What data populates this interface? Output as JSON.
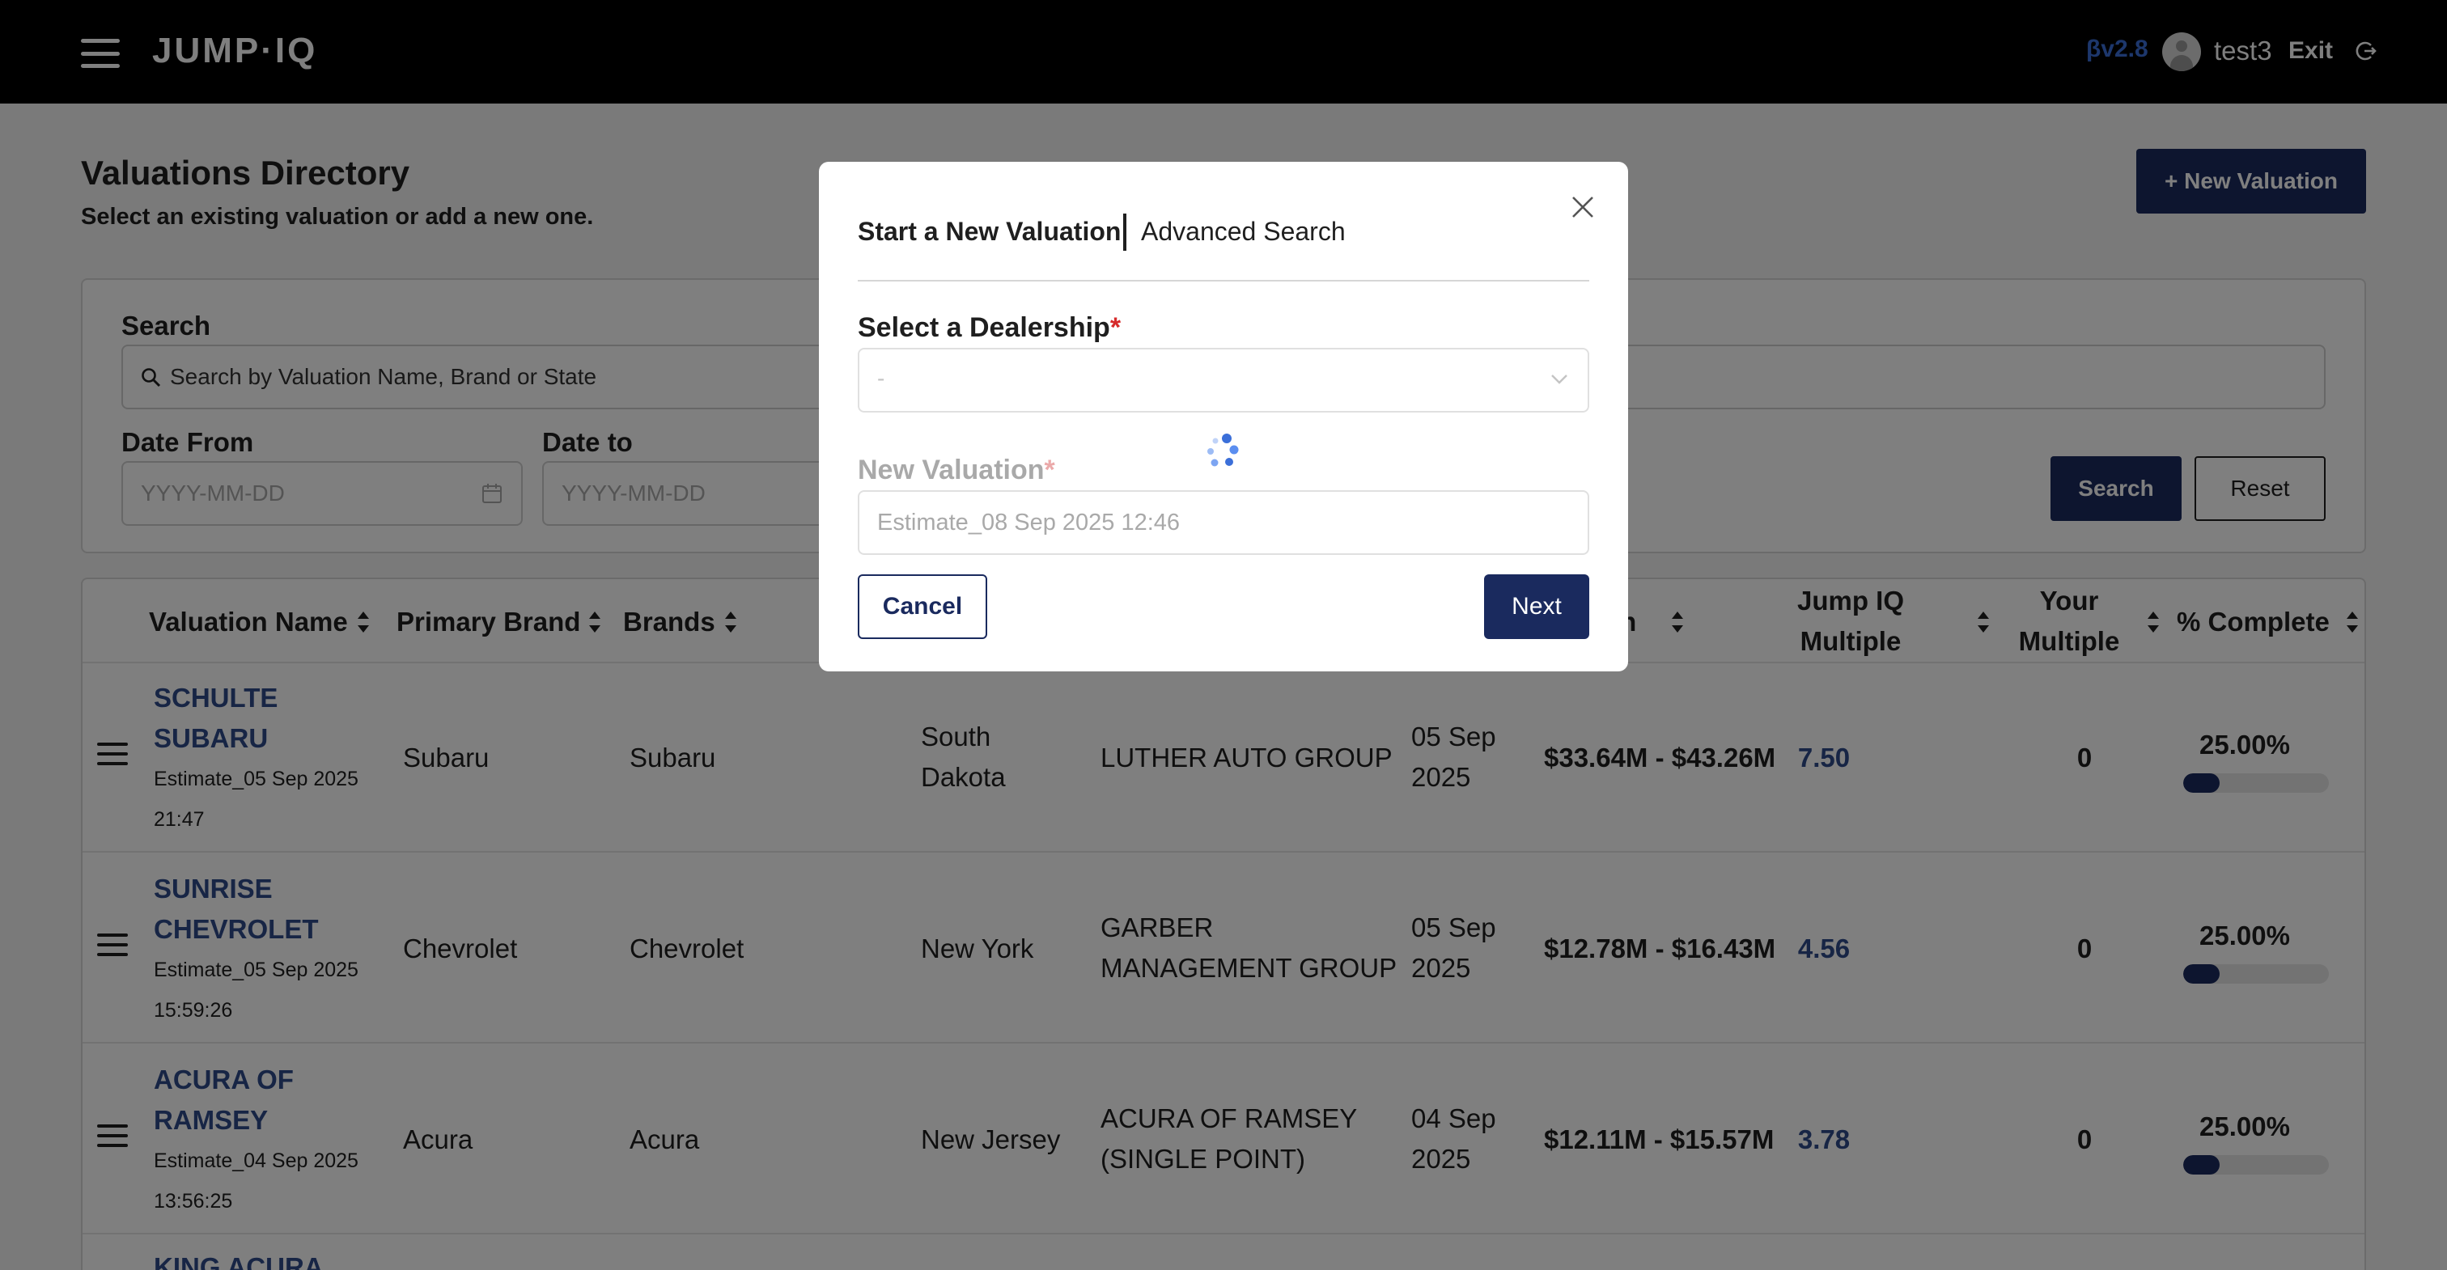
{
  "header": {
    "logo": "JUMP·IQ",
    "version": "βv2.8",
    "username": "test3",
    "exit_label": "Exit"
  },
  "page": {
    "title": "Valuations Directory",
    "subtitle": "Select an existing valuation or add a new one.",
    "new_valuation_label": "+ New Valuation"
  },
  "filters": {
    "search_label": "Search",
    "search_placeholder": "Search by Valuation Name, Brand or State",
    "date_from_label": "Date From",
    "date_to_label": "Date to",
    "date_placeholder": "YYYY-MM-DD",
    "search_button": "Search",
    "reset_button": "Reset"
  },
  "table": {
    "columns": {
      "valuation_name": "Valuation Name",
      "primary_brand": "Primary Brand",
      "brands": "Brands",
      "valuation": "on",
      "jump_iq_multiple_1": "Jump IQ",
      "jump_iq_multiple_2": "Multiple",
      "your_multiple_1": "Your",
      "your_multiple_2": "Multiple",
      "pct_complete": "% Complete"
    },
    "rows": [
      {
        "name_1": "SCHULTE",
        "name_2": "SUBARU",
        "estimate_1": "Estimate_05 Sep 2025",
        "estimate_2": "21:47",
        "primary_brand": "Subaru",
        "brands": "Subaru",
        "state_1": "South",
        "state_2": "Dakota",
        "group_1": "LUTHER AUTO GROUP",
        "group_2": "",
        "date_1": "05 Sep",
        "date_2": "2025",
        "valuation": "$33.64M - $43.26M",
        "jump_iq_multiple": "7.50",
        "your_multiple": "0",
        "pct_complete": "25.00%",
        "pct_value": 25
      },
      {
        "name_1": "SUNRISE",
        "name_2": "CHEVROLET",
        "estimate_1": "Estimate_05 Sep 2025",
        "estimate_2": "15:59:26",
        "primary_brand": "Chevrolet",
        "brands": "Chevrolet",
        "state_1": "New York",
        "state_2": "",
        "group_1": "GARBER",
        "group_2": "MANAGEMENT GROUP",
        "date_1": "05 Sep",
        "date_2": "2025",
        "valuation": "$12.78M - $16.43M",
        "jump_iq_multiple": "4.56",
        "your_multiple": "0",
        "pct_complete": "25.00%",
        "pct_value": 25
      },
      {
        "name_1": "ACURA OF",
        "name_2": "RAMSEY",
        "estimate_1": "Estimate_04 Sep 2025",
        "estimate_2": "13:56:25",
        "primary_brand": "Acura",
        "brands": "Acura",
        "state_1": "New Jersey",
        "state_2": "",
        "group_1": "ACURA OF RAMSEY",
        "group_2": "(SINGLE POINT)",
        "date_1": "04 Sep",
        "date_2": "2025",
        "valuation": "$12.11M - $15.57M",
        "jump_iq_multiple": "3.78",
        "your_multiple": "0",
        "pct_complete": "25.00%",
        "pct_value": 25
      }
    ],
    "partial_row_name": "KING ACURA"
  },
  "modal": {
    "tab_active": "Start a New Valuation",
    "tab_other": "Advanced Search",
    "dealership_label": "Select a Dealership",
    "required_mark": "*",
    "dealership_value": "-",
    "new_valuation_label": "New Valuation",
    "new_valuation_placeholder": "Estimate_08 Sep 2025 12:46",
    "cancel_label": "Cancel",
    "next_label": "Next"
  },
  "colors": {
    "navy": "#1a2a5e",
    "link_blue": "#2f4b8a",
    "version_blue": "#3b6fd9",
    "required_red": "#d62b2b"
  }
}
